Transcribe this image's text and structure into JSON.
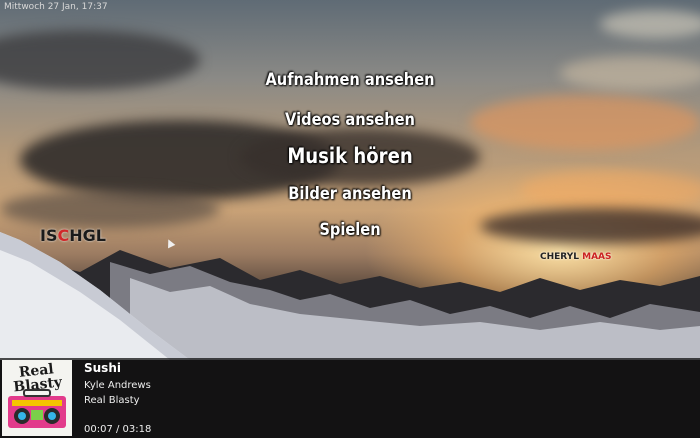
{
  "status": {
    "datetime": "Mittwoch 27 Jan, 17:37"
  },
  "menu": {
    "items": [
      {
        "label": "Aufnahmen ansehen"
      },
      {
        "label": "Videos ansehen"
      },
      {
        "label": "Musik hören",
        "selected": true
      },
      {
        "label": "Bilder ansehen"
      },
      {
        "label": "Spielen"
      }
    ]
  },
  "background": {
    "logo_left": {
      "pre": "IS",
      "hl": "C",
      "post": "HGL"
    },
    "logo_right": {
      "name": "CHERYL",
      "hl": "MAAS"
    }
  },
  "now_playing": {
    "title": "Sushi",
    "artist": "Kyle Andrews",
    "album": "Real Blasty",
    "time": "00:07 / 03:18",
    "cover_text": "Real Blasty"
  },
  "colors": {
    "text": "#ffffff",
    "panel": "#0a0a0a",
    "accent_red": "#d12a2a"
  }
}
